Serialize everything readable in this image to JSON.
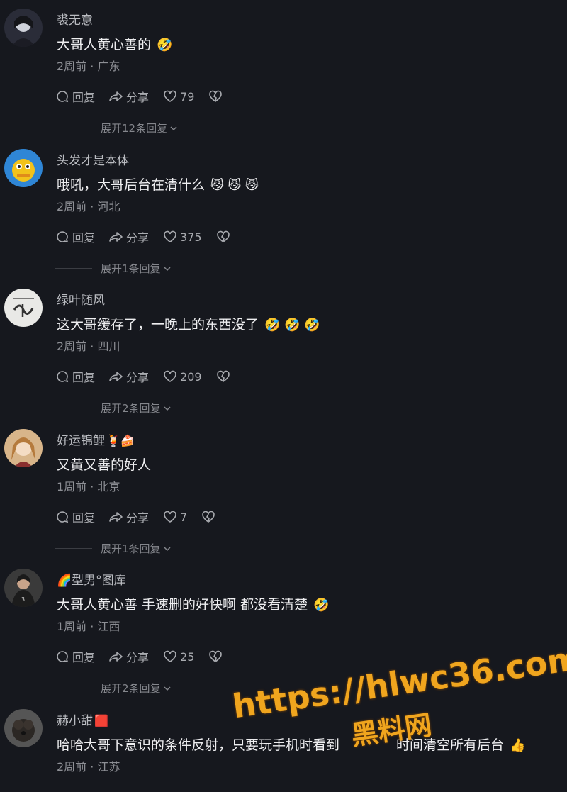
{
  "comments": [
    {
      "username": "裘无意",
      "user_emoji": "",
      "text": "大哥人黄心善的",
      "text_emoji": "🤣",
      "time": "2周前",
      "location": "广东",
      "likes": "79",
      "reply_label": "回复",
      "share_label": "分享",
      "expand_label": "展开12条回复",
      "avatar_color": "#2a2c38"
    },
    {
      "username": "头发才是本体",
      "user_emoji": "",
      "text": "哦吼，大哥后台在清什么",
      "text_emoji": "😼 😼 😼",
      "time": "2周前",
      "location": "河北",
      "likes": "375",
      "reply_label": "回复",
      "share_label": "分享",
      "expand_label": "展开1条回复",
      "avatar_color": "#2f86d6"
    },
    {
      "username": "绿叶随风",
      "user_emoji": "",
      "text": "这大哥缓存了，一晚上的东西没了",
      "text_emoji": "🤣 🤣 🤣",
      "time": "2周前",
      "location": "四川",
      "likes": "209",
      "reply_label": "回复",
      "share_label": "分享",
      "expand_label": "展开2条回复",
      "avatar_color": "#e9e9e6"
    },
    {
      "username": "好运锦鲤",
      "user_emoji": "🍹🍰",
      "text": "又黄又善的好人",
      "text_emoji": "",
      "time": "1周前",
      "location": "北京",
      "likes": "7",
      "reply_label": "回复",
      "share_label": "分享",
      "expand_label": "展开1条回复",
      "avatar_color": "#d8b58a"
    },
    {
      "username": "🌈型男°图库",
      "user_emoji": "",
      "text": "大哥人黄心善 手速删的好快啊 都没看清楚",
      "text_emoji": "🤣",
      "time": "1周前",
      "location": "江西",
      "likes": "25",
      "reply_label": "回复",
      "share_label": "分享",
      "expand_label": "展开2条回复",
      "avatar_color": "#3a3a3a"
    },
    {
      "username": "赫小甜",
      "user_emoji": "🟥",
      "text": "哈哈大哥下意识的条件反射，只要玩手机时看到",
      "text_tail": "时间清空所有后台",
      "text_emoji": "👍",
      "time": "2周前",
      "location": "江苏",
      "likes": "",
      "reply_label": "",
      "share_label": "",
      "expand_label": "",
      "avatar_color": "#555"
    }
  ],
  "watermark": {
    "url": "https://hlwc36.com",
    "name": "黑料网"
  }
}
